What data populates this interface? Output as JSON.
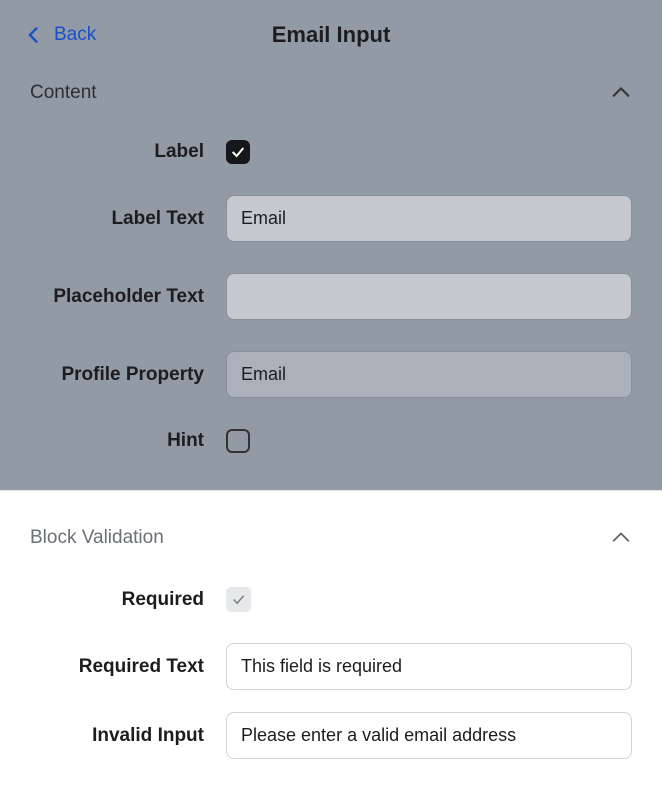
{
  "header": {
    "back_label": "Back",
    "title": "Email Input"
  },
  "sections": {
    "content": {
      "title": "Content",
      "fields": {
        "label": {
          "name": "Label",
          "checked": true
        },
        "label_text": {
          "name": "Label Text",
          "value": "Email"
        },
        "placeholder_text": {
          "name": "Placeholder Text",
          "value": ""
        },
        "profile_property": {
          "name": "Profile Property",
          "value": "Email"
        },
        "hint": {
          "name": "Hint",
          "checked": false
        }
      }
    },
    "block_validation": {
      "title": "Block Validation",
      "fields": {
        "required": {
          "name": "Required",
          "checked": true
        },
        "required_text": {
          "name": "Required Text",
          "value": "This field is required"
        },
        "invalid_input": {
          "name": "Invalid Input",
          "value": "Please enter a valid email address"
        }
      }
    }
  }
}
